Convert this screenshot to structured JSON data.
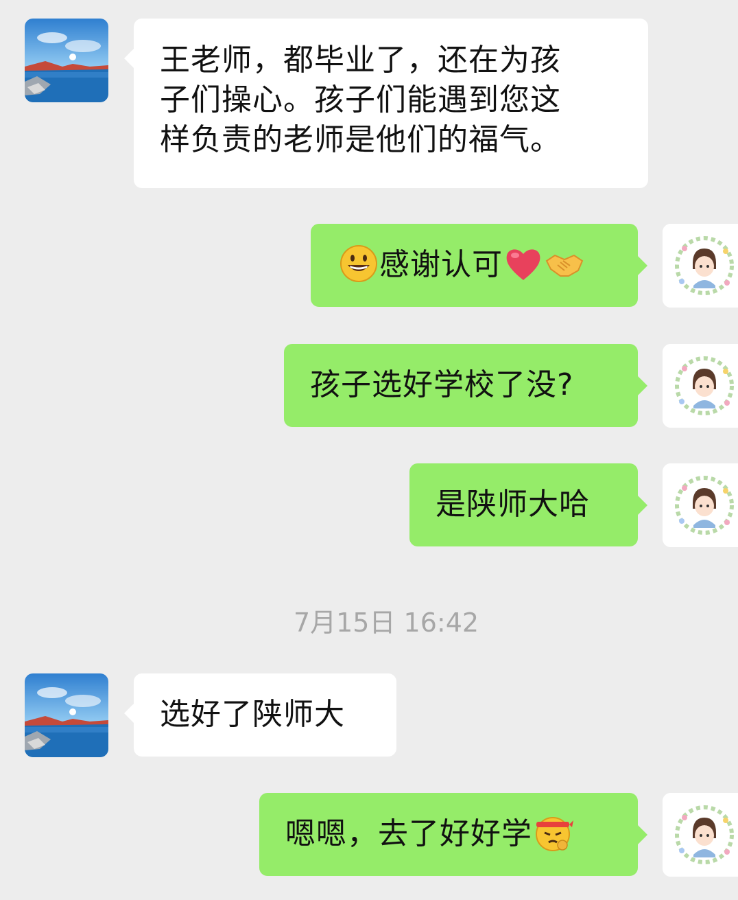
{
  "messages": [
    {
      "sender": "other",
      "lines": [
        "王老师，都毕业了，还在为孩",
        "子们操心。孩子们能遇到您这",
        "样负责的老师是他们的福气。"
      ]
    },
    {
      "sender": "self",
      "text": "感谢认可",
      "emojis": [
        "smiling-face-icon",
        "heart-icon",
        "handshake-icon"
      ]
    },
    {
      "sender": "self",
      "text": "孩子选好学校了没?"
    },
    {
      "sender": "self",
      "text": "是陕师大哈"
    },
    {
      "sender": "other",
      "text": "选好了陕师大"
    },
    {
      "sender": "self",
      "text": "嗯嗯，去了好好学",
      "emojis": [
        "determined-face-icon"
      ]
    }
  ],
  "timestamp": "7月15日 16:42",
  "colors": {
    "background": "#ededed",
    "incoming_bubble": "#ffffff",
    "outgoing_bubble": "#95ec69",
    "timestamp_text": "#a7a7a7"
  }
}
